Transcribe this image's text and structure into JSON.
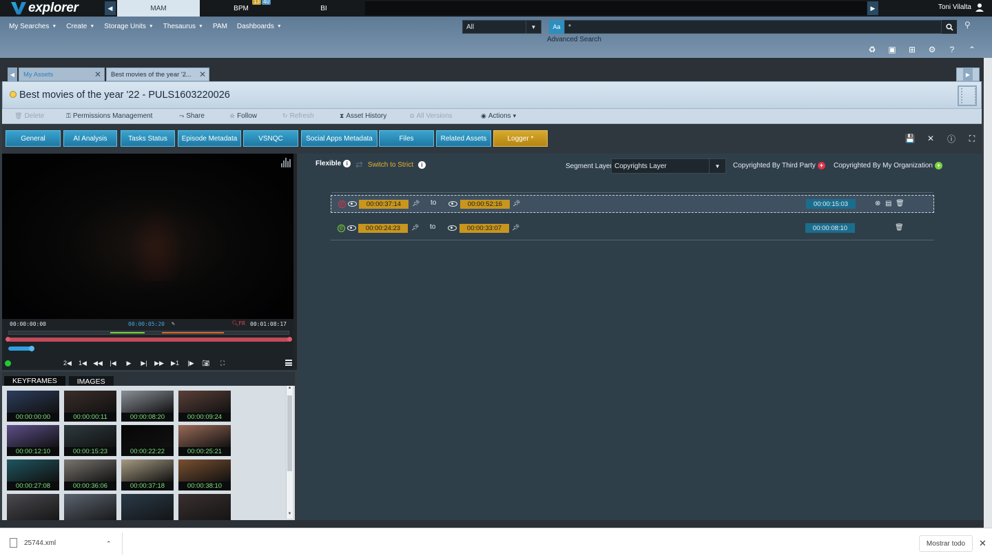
{
  "topbar": {
    "logo": "explorer",
    "modules": [
      {
        "label": "MAM",
        "active": true
      },
      {
        "label": "BPM",
        "active": false,
        "badges": [
          "13",
          "40"
        ]
      },
      {
        "label": "BI",
        "active": false
      }
    ],
    "user": "Toni Vilalta"
  },
  "menu": {
    "items": [
      "My Searches",
      "Create",
      "Storage Units",
      "Thesaurus",
      "PAM",
      "Dashboards"
    ],
    "search_scope": "All",
    "aa_label": "Aa",
    "search_value": "*",
    "advanced_search": "Advanced Search"
  },
  "asset_tabs": [
    {
      "label": "My Assets"
    },
    {
      "label": "Best movies of the year '2..."
    }
  ],
  "asset": {
    "title": "Best movies of the year '22 - PULS1603220026"
  },
  "actions": [
    {
      "label": "Delete",
      "disabled": true
    },
    {
      "label": "Permissions Management",
      "disabled": false
    },
    {
      "label": "Share",
      "disabled": false
    },
    {
      "label": "Follow",
      "disabled": false
    },
    {
      "label": "Refresh",
      "disabled": true
    },
    {
      "label": "Asset History",
      "disabled": false
    },
    {
      "label": "All Versions",
      "disabled": true
    },
    {
      "label": "Actions",
      "disabled": false
    }
  ],
  "main_tabs": [
    {
      "label": "General"
    },
    {
      "label": "AI Analysis"
    },
    {
      "label": "Tasks Status"
    },
    {
      "label": "Episode Metadata"
    },
    {
      "label": "VSNQC"
    },
    {
      "label": "Social Apps Metadata"
    },
    {
      "label": "Files"
    },
    {
      "label": "Related Assets"
    },
    {
      "label": "Logger *",
      "active": true
    }
  ],
  "player": {
    "tc_start": "00:00:00:00",
    "tc_current": "00:00:05:20",
    "tc_end": "00:01:08:17",
    "zoom_label": "FR",
    "progress": 0.08
  },
  "keyframes": {
    "tabs": [
      "KEYFRAMES",
      "IMAGES"
    ],
    "items": [
      {
        "tc": "00:00:00:00",
        "color": "#2c3d5c"
      },
      {
        "tc": "00:00:00:11",
        "color": "#3a2e2a"
      },
      {
        "tc": "00:00:08:20",
        "color": "#8a9098"
      },
      {
        "tc": "00:00:09:24",
        "color": "#5a4038"
      },
      {
        "tc": "00:00:12:10",
        "color": "#5e4f8a"
      },
      {
        "tc": "00:00:15:23",
        "color": "#2e3b40"
      },
      {
        "tc": "00:00:22:22",
        "color": "#060606"
      },
      {
        "tc": "00:00:25:21",
        "color": "#9a6a58"
      },
      {
        "tc": "00:00:27:08",
        "color": "#1e5660"
      },
      {
        "tc": "00:00:36:06",
        "color": "#7a7570"
      },
      {
        "tc": "00:00:37:18",
        "color": "#a69a82"
      },
      {
        "tc": "00:00:38:10",
        "color": "#7a5030"
      },
      {
        "tc": "",
        "color": "#4a4a50"
      },
      {
        "tc": "",
        "color": "#5c6470"
      },
      {
        "tc": "",
        "color": "#2a3a48"
      },
      {
        "tc": "",
        "color": "#3a3030"
      }
    ]
  },
  "logger": {
    "mode": "Flexible",
    "switch_label": "Switch to Strict",
    "segment_layer_label": "Segment Layer",
    "segment_layer_value": "Copyrights Layer",
    "legend_third_party": "Copyrighted By Third Party",
    "legend_my_org": "Copyrighted By My Organization",
    "to_label": "to",
    "segments": [
      {
        "in": "00:00:37:14",
        "out": "00:00:52:16",
        "duration": "00:00:15:03",
        "copyright": "third-party",
        "selected": true
      },
      {
        "in": "00:00:24:23",
        "out": "00:00:33:07",
        "duration": "00:00:08:10",
        "copyright": "my-organization",
        "selected": false
      }
    ]
  },
  "download": {
    "file": "25744.xml",
    "show_all": "Mostrar todo"
  }
}
